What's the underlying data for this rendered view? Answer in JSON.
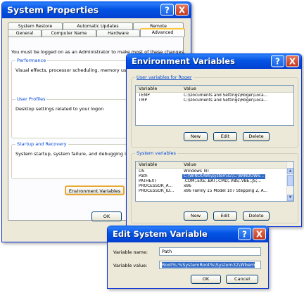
{
  "system_properties": {
    "title": "System Properties",
    "tabs_row1": [
      "System Restore",
      "Automatic Updates",
      "Remote"
    ],
    "tabs_row2": [
      "General",
      "Computer Name",
      "Hardware",
      "Advanced"
    ],
    "admin_notice": "You must be logged on as an Administrator to make most of these changes.",
    "performance": {
      "label": "Performance",
      "text": "Visual effects, processor scheduling, memory usag"
    },
    "user_profiles": {
      "label": "User Profiles",
      "text": "Desktop settings related to your logon"
    },
    "startup": {
      "label": "Startup and Recovery",
      "text": "System startup, system failure, and debugging infor"
    },
    "env_button": "Environment Variables",
    "ok_button": "OK"
  },
  "environment_variables": {
    "title": "Environment Variables",
    "user_group_label": "User variables for Roger",
    "columns": [
      "Variable",
      "Value"
    ],
    "user_vars": [
      {
        "name": "TEMP",
        "value": "C:\\Documents and Settings\\Roger\\Loca..."
      },
      {
        "name": "TMP",
        "value": "C:\\Documents and Settings\\Roger\\Loca..."
      }
    ],
    "user_buttons": {
      "new": "New",
      "edit": "Edit",
      "delete": "Delete"
    },
    "system_group_label": "System variables",
    "system_vars": [
      {
        "name": "OS",
        "value": "Windows_NT"
      },
      {
        "name": "Path",
        "value": "C:\\WINDOWS\\system32;C:\\WINDOWS..."
      },
      {
        "name": "PATHEXT",
        "value": ".COM;.EXE;.BAT;.CMD;.VBS;.VBE;.JS;..."
      },
      {
        "name": "PROCESSOR_A...",
        "value": "x86"
      },
      {
        "name": "PROCESSOR_ID...",
        "value": "x86 Family 15 Model 107 Stepping 2, A..."
      }
    ],
    "system_buttons": {
      "new": "New",
      "edit": "Edit",
      "delete": "Delete"
    },
    "selected_system_row": 1
  },
  "edit_system_variable": {
    "title": "Edit System Variable",
    "name_label": "Variable name:",
    "name_value": "Path",
    "value_label": "Variable value:",
    "value_value": "Root%;%SystemRoot%\\System32\\Wbem",
    "ok_button": "OK",
    "cancel_button": "Cancel"
  },
  "title_buttons": {
    "help": "?",
    "close": "X"
  },
  "colors": {
    "titlebar": "#0454e4",
    "window_bg": "#ece9d8",
    "selection": "#316ac5",
    "close": "#c2371a"
  }
}
